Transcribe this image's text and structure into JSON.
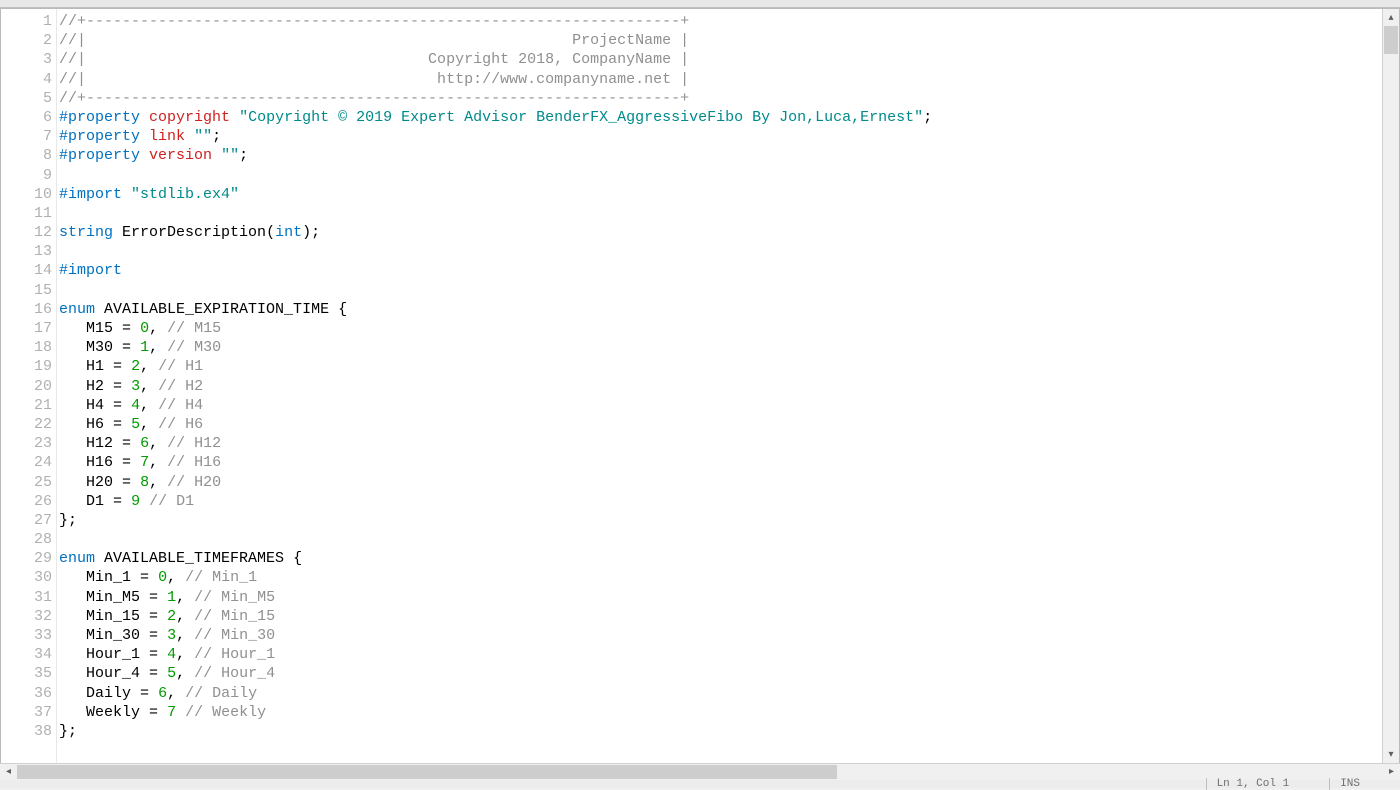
{
  "status": {
    "position": "Ln 1, Col 1",
    "mode": "INS"
  },
  "code": {
    "lines": [
      {
        "n": 1,
        "tokens": [
          {
            "c": "tok-comment",
            "t": "//+------------------------------------------------------------------+"
          }
        ]
      },
      {
        "n": 2,
        "tokens": [
          {
            "c": "tok-comment",
            "t": "//|                                                      ProjectName |"
          }
        ]
      },
      {
        "n": 3,
        "tokens": [
          {
            "c": "tok-comment",
            "t": "//|                                      Copyright 2018, CompanyName |"
          }
        ]
      },
      {
        "n": 4,
        "tokens": [
          {
            "c": "tok-comment",
            "t": "//|                                       http://www.companyname.net |"
          }
        ]
      },
      {
        "n": 5,
        "tokens": [
          {
            "c": "tok-comment",
            "t": "//+------------------------------------------------------------------+"
          }
        ]
      },
      {
        "n": 6,
        "tokens": [
          {
            "c": "tok-preproc",
            "t": "#property"
          },
          {
            "c": "",
            "t": " "
          },
          {
            "c": "tok-preprocattr",
            "t": "copyright"
          },
          {
            "c": "",
            "t": " "
          },
          {
            "c": "tok-string",
            "t": "\"Copyright © 2019 Expert Advisor BenderFX_AggressiveFibo By Jon,Luca,Ernest\""
          },
          {
            "c": "tok-punct",
            "t": ";"
          }
        ]
      },
      {
        "n": 7,
        "tokens": [
          {
            "c": "tok-preproc",
            "t": "#property"
          },
          {
            "c": "",
            "t": " "
          },
          {
            "c": "tok-preprocattr",
            "t": "link"
          },
          {
            "c": "",
            "t": " "
          },
          {
            "c": "tok-string",
            "t": "\"\""
          },
          {
            "c": "tok-punct",
            "t": ";"
          }
        ]
      },
      {
        "n": 8,
        "tokens": [
          {
            "c": "tok-preproc",
            "t": "#property"
          },
          {
            "c": "",
            "t": " "
          },
          {
            "c": "tok-preprocattr",
            "t": "version"
          },
          {
            "c": "",
            "t": " "
          },
          {
            "c": "tok-string",
            "t": "\"\""
          },
          {
            "c": "tok-punct",
            "t": ";"
          }
        ]
      },
      {
        "n": 9,
        "tokens": [
          {
            "c": "",
            "t": ""
          }
        ]
      },
      {
        "n": 10,
        "tokens": [
          {
            "c": "tok-preproc",
            "t": "#import"
          },
          {
            "c": "",
            "t": " "
          },
          {
            "c": "tok-string",
            "t": "\"stdlib.ex4\""
          }
        ]
      },
      {
        "n": 11,
        "tokens": [
          {
            "c": "",
            "t": ""
          }
        ]
      },
      {
        "n": 12,
        "tokens": [
          {
            "c": "tok-type",
            "t": "string"
          },
          {
            "c": "",
            "t": " "
          },
          {
            "c": "tok-ident",
            "t": "ErrorDescription"
          },
          {
            "c": "tok-punct",
            "t": "("
          },
          {
            "c": "tok-type",
            "t": "int"
          },
          {
            "c": "tok-punct",
            "t": ");"
          }
        ]
      },
      {
        "n": 13,
        "tokens": [
          {
            "c": "",
            "t": ""
          }
        ]
      },
      {
        "n": 14,
        "tokens": [
          {
            "c": "tok-preproc",
            "t": "#import"
          }
        ]
      },
      {
        "n": 15,
        "tokens": [
          {
            "c": "",
            "t": ""
          }
        ]
      },
      {
        "n": 16,
        "tokens": [
          {
            "c": "tok-keyword",
            "t": "enum"
          },
          {
            "c": "",
            "t": " "
          },
          {
            "c": "tok-ident",
            "t": "AVAILABLE_EXPIRATION_TIME"
          },
          {
            "c": "",
            "t": " "
          },
          {
            "c": "tok-punct",
            "t": "{"
          }
        ]
      },
      {
        "n": 17,
        "tokens": [
          {
            "c": "",
            "t": "   "
          },
          {
            "c": "tok-ident",
            "t": "M15"
          },
          {
            "c": "",
            "t": " "
          },
          {
            "c": "tok-punct",
            "t": "="
          },
          {
            "c": "",
            "t": " "
          },
          {
            "c": "tok-number",
            "t": "0"
          },
          {
            "c": "tok-punct",
            "t": ","
          },
          {
            "c": "",
            "t": " "
          },
          {
            "c": "tok-comment",
            "t": "// M15"
          }
        ]
      },
      {
        "n": 18,
        "tokens": [
          {
            "c": "",
            "t": "   "
          },
          {
            "c": "tok-ident",
            "t": "M30"
          },
          {
            "c": "",
            "t": " "
          },
          {
            "c": "tok-punct",
            "t": "="
          },
          {
            "c": "",
            "t": " "
          },
          {
            "c": "tok-number",
            "t": "1"
          },
          {
            "c": "tok-punct",
            "t": ","
          },
          {
            "c": "",
            "t": " "
          },
          {
            "c": "tok-comment",
            "t": "// M30"
          }
        ]
      },
      {
        "n": 19,
        "tokens": [
          {
            "c": "",
            "t": "   "
          },
          {
            "c": "tok-ident",
            "t": "H1"
          },
          {
            "c": "",
            "t": " "
          },
          {
            "c": "tok-punct",
            "t": "="
          },
          {
            "c": "",
            "t": " "
          },
          {
            "c": "tok-number",
            "t": "2"
          },
          {
            "c": "tok-punct",
            "t": ","
          },
          {
            "c": "",
            "t": " "
          },
          {
            "c": "tok-comment",
            "t": "// H1"
          }
        ]
      },
      {
        "n": 20,
        "tokens": [
          {
            "c": "",
            "t": "   "
          },
          {
            "c": "tok-ident",
            "t": "H2"
          },
          {
            "c": "",
            "t": " "
          },
          {
            "c": "tok-punct",
            "t": "="
          },
          {
            "c": "",
            "t": " "
          },
          {
            "c": "tok-number",
            "t": "3"
          },
          {
            "c": "tok-punct",
            "t": ","
          },
          {
            "c": "",
            "t": " "
          },
          {
            "c": "tok-comment",
            "t": "// H2"
          }
        ]
      },
      {
        "n": 21,
        "tokens": [
          {
            "c": "",
            "t": "   "
          },
          {
            "c": "tok-ident",
            "t": "H4"
          },
          {
            "c": "",
            "t": " "
          },
          {
            "c": "tok-punct",
            "t": "="
          },
          {
            "c": "",
            "t": " "
          },
          {
            "c": "tok-number",
            "t": "4"
          },
          {
            "c": "tok-punct",
            "t": ","
          },
          {
            "c": "",
            "t": " "
          },
          {
            "c": "tok-comment",
            "t": "// H4"
          }
        ]
      },
      {
        "n": 22,
        "tokens": [
          {
            "c": "",
            "t": "   "
          },
          {
            "c": "tok-ident",
            "t": "H6"
          },
          {
            "c": "",
            "t": " "
          },
          {
            "c": "tok-punct",
            "t": "="
          },
          {
            "c": "",
            "t": " "
          },
          {
            "c": "tok-number",
            "t": "5"
          },
          {
            "c": "tok-punct",
            "t": ","
          },
          {
            "c": "",
            "t": " "
          },
          {
            "c": "tok-comment",
            "t": "// H6"
          }
        ]
      },
      {
        "n": 23,
        "tokens": [
          {
            "c": "",
            "t": "   "
          },
          {
            "c": "tok-ident",
            "t": "H12"
          },
          {
            "c": "",
            "t": " "
          },
          {
            "c": "tok-punct",
            "t": "="
          },
          {
            "c": "",
            "t": " "
          },
          {
            "c": "tok-number",
            "t": "6"
          },
          {
            "c": "tok-punct",
            "t": ","
          },
          {
            "c": "",
            "t": " "
          },
          {
            "c": "tok-comment",
            "t": "// H12"
          }
        ]
      },
      {
        "n": 24,
        "tokens": [
          {
            "c": "",
            "t": "   "
          },
          {
            "c": "tok-ident",
            "t": "H16"
          },
          {
            "c": "",
            "t": " "
          },
          {
            "c": "tok-punct",
            "t": "="
          },
          {
            "c": "",
            "t": " "
          },
          {
            "c": "tok-number",
            "t": "7"
          },
          {
            "c": "tok-punct",
            "t": ","
          },
          {
            "c": "",
            "t": " "
          },
          {
            "c": "tok-comment",
            "t": "// H16"
          }
        ]
      },
      {
        "n": 25,
        "tokens": [
          {
            "c": "",
            "t": "   "
          },
          {
            "c": "tok-ident",
            "t": "H20"
          },
          {
            "c": "",
            "t": " "
          },
          {
            "c": "tok-punct",
            "t": "="
          },
          {
            "c": "",
            "t": " "
          },
          {
            "c": "tok-number",
            "t": "8"
          },
          {
            "c": "tok-punct",
            "t": ","
          },
          {
            "c": "",
            "t": " "
          },
          {
            "c": "tok-comment",
            "t": "// H20"
          }
        ]
      },
      {
        "n": 26,
        "tokens": [
          {
            "c": "",
            "t": "   "
          },
          {
            "c": "tok-ident",
            "t": "D1"
          },
          {
            "c": "",
            "t": " "
          },
          {
            "c": "tok-punct",
            "t": "="
          },
          {
            "c": "",
            "t": " "
          },
          {
            "c": "tok-number",
            "t": "9"
          },
          {
            "c": "",
            "t": " "
          },
          {
            "c": "tok-comment",
            "t": "// D1"
          }
        ]
      },
      {
        "n": 27,
        "tokens": [
          {
            "c": "tok-punct",
            "t": "};"
          }
        ]
      },
      {
        "n": 28,
        "tokens": [
          {
            "c": "",
            "t": ""
          }
        ]
      },
      {
        "n": 29,
        "tokens": [
          {
            "c": "tok-keyword",
            "t": "enum"
          },
          {
            "c": "",
            "t": " "
          },
          {
            "c": "tok-ident",
            "t": "AVAILABLE_TIMEFRAMES"
          },
          {
            "c": "",
            "t": " "
          },
          {
            "c": "tok-punct",
            "t": "{"
          }
        ]
      },
      {
        "n": 30,
        "tokens": [
          {
            "c": "",
            "t": "   "
          },
          {
            "c": "tok-ident",
            "t": "Min_1"
          },
          {
            "c": "",
            "t": " "
          },
          {
            "c": "tok-punct",
            "t": "="
          },
          {
            "c": "",
            "t": " "
          },
          {
            "c": "tok-number",
            "t": "0"
          },
          {
            "c": "tok-punct",
            "t": ","
          },
          {
            "c": "",
            "t": " "
          },
          {
            "c": "tok-comment",
            "t": "// Min_1"
          }
        ]
      },
      {
        "n": 31,
        "tokens": [
          {
            "c": "",
            "t": "   "
          },
          {
            "c": "tok-ident",
            "t": "Min_M5"
          },
          {
            "c": "",
            "t": " "
          },
          {
            "c": "tok-punct",
            "t": "="
          },
          {
            "c": "",
            "t": " "
          },
          {
            "c": "tok-number",
            "t": "1"
          },
          {
            "c": "tok-punct",
            "t": ","
          },
          {
            "c": "",
            "t": " "
          },
          {
            "c": "tok-comment",
            "t": "// Min_M5"
          }
        ]
      },
      {
        "n": 32,
        "tokens": [
          {
            "c": "",
            "t": "   "
          },
          {
            "c": "tok-ident",
            "t": "Min_15"
          },
          {
            "c": "",
            "t": " "
          },
          {
            "c": "tok-punct",
            "t": "="
          },
          {
            "c": "",
            "t": " "
          },
          {
            "c": "tok-number",
            "t": "2"
          },
          {
            "c": "tok-punct",
            "t": ","
          },
          {
            "c": "",
            "t": " "
          },
          {
            "c": "tok-comment",
            "t": "// Min_15"
          }
        ]
      },
      {
        "n": 33,
        "tokens": [
          {
            "c": "",
            "t": "   "
          },
          {
            "c": "tok-ident",
            "t": "Min_30"
          },
          {
            "c": "",
            "t": " "
          },
          {
            "c": "tok-punct",
            "t": "="
          },
          {
            "c": "",
            "t": " "
          },
          {
            "c": "tok-number",
            "t": "3"
          },
          {
            "c": "tok-punct",
            "t": ","
          },
          {
            "c": "",
            "t": " "
          },
          {
            "c": "tok-comment",
            "t": "// Min_30"
          }
        ]
      },
      {
        "n": 34,
        "tokens": [
          {
            "c": "",
            "t": "   "
          },
          {
            "c": "tok-ident",
            "t": "Hour_1"
          },
          {
            "c": "",
            "t": " "
          },
          {
            "c": "tok-punct",
            "t": "="
          },
          {
            "c": "",
            "t": " "
          },
          {
            "c": "tok-number",
            "t": "4"
          },
          {
            "c": "tok-punct",
            "t": ","
          },
          {
            "c": "",
            "t": " "
          },
          {
            "c": "tok-comment",
            "t": "// Hour_1"
          }
        ]
      },
      {
        "n": 35,
        "tokens": [
          {
            "c": "",
            "t": "   "
          },
          {
            "c": "tok-ident",
            "t": "Hour_4"
          },
          {
            "c": "",
            "t": " "
          },
          {
            "c": "tok-punct",
            "t": "="
          },
          {
            "c": "",
            "t": " "
          },
          {
            "c": "tok-number",
            "t": "5"
          },
          {
            "c": "tok-punct",
            "t": ","
          },
          {
            "c": "",
            "t": " "
          },
          {
            "c": "tok-comment",
            "t": "// Hour_4"
          }
        ]
      },
      {
        "n": 36,
        "tokens": [
          {
            "c": "",
            "t": "   "
          },
          {
            "c": "tok-ident",
            "t": "Daily"
          },
          {
            "c": "",
            "t": " "
          },
          {
            "c": "tok-punct",
            "t": "="
          },
          {
            "c": "",
            "t": " "
          },
          {
            "c": "tok-number",
            "t": "6"
          },
          {
            "c": "tok-punct",
            "t": ","
          },
          {
            "c": "",
            "t": " "
          },
          {
            "c": "tok-comment",
            "t": "// Daily"
          }
        ]
      },
      {
        "n": 37,
        "tokens": [
          {
            "c": "",
            "t": "   "
          },
          {
            "c": "tok-ident",
            "t": "Weekly"
          },
          {
            "c": "",
            "t": " "
          },
          {
            "c": "tok-punct",
            "t": "="
          },
          {
            "c": "",
            "t": " "
          },
          {
            "c": "tok-number",
            "t": "7"
          },
          {
            "c": "",
            "t": " "
          },
          {
            "c": "tok-comment",
            "t": "// Weekly"
          }
        ]
      },
      {
        "n": 38,
        "tokens": [
          {
            "c": "tok-punct",
            "t": "};"
          }
        ]
      }
    ]
  }
}
